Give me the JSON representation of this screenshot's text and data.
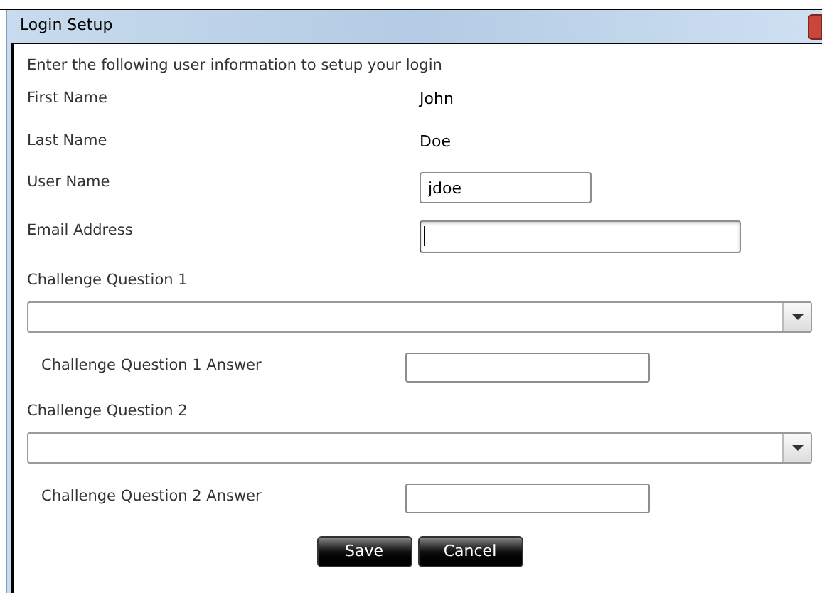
{
  "window": {
    "title": "Login Setup"
  },
  "instructions": "Enter the following user information to setup your login",
  "rows": [
    {
      "kind": "static",
      "label": "First Name",
      "value": "John"
    },
    {
      "kind": "static",
      "label": "Last Name",
      "value": "Doe"
    },
    {
      "kind": "input",
      "label": "User Name",
      "value": "jdoe"
    },
    {
      "kind": "wideinput",
      "label": "Email Address",
      "focused": true
    },
    {
      "kind": "combo",
      "label": "Challenge Question 1"
    },
    {
      "kind": "answer",
      "label": "Challenge Question 1 Answer"
    },
    {
      "kind": "combo",
      "label": "Challenge Question 2"
    },
    {
      "kind": "answer",
      "label": "Challenge Question 2 Answer"
    }
  ],
  "buttons": [
    "Save",
    "Cancel"
  ]
}
